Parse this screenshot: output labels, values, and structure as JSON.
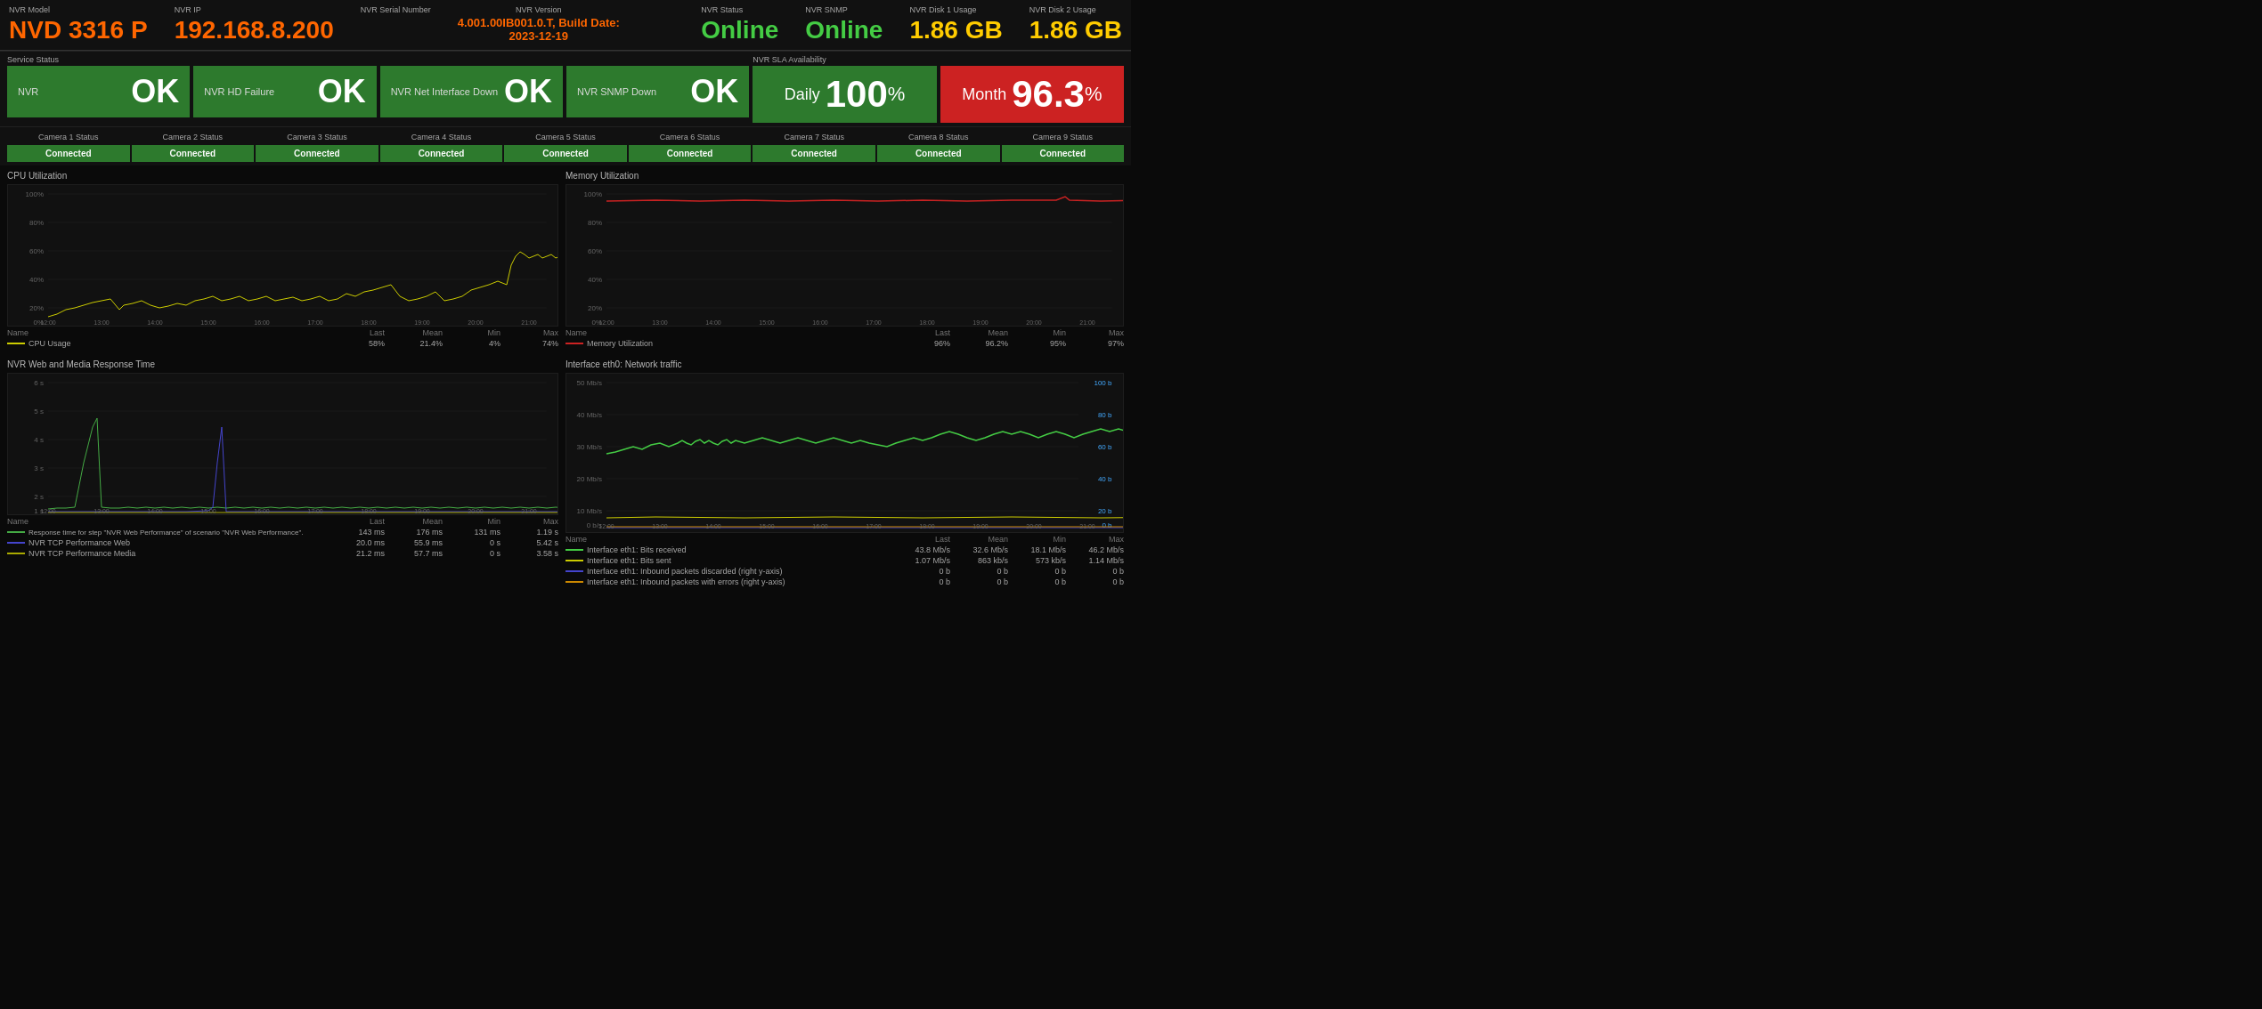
{
  "header": {
    "nvr_model_label": "NVR Model",
    "nvr_model_value": "NVD 3316 P",
    "nvr_ip_label": "NVR IP",
    "nvr_ip_value": "192.168.8.200",
    "nvr_serial_label": "NVR Serial Number",
    "nvr_serial_value": "",
    "nvr_version_label": "NVR Version",
    "nvr_version_value": "4.001.00IB001.0.T, Build Date:\n2023-12-19",
    "nvr_status_label": "NVR Status",
    "nvr_status_value": "Online",
    "nvr_snmp_label": "NVR SNMP",
    "nvr_snmp_value": "Online",
    "nvr_disk1_label": "NVR Disk 1 Usage",
    "nvr_disk1_value": "1.86 GB",
    "nvr_disk2_label": "NVR Disk 2 Usage",
    "nvr_disk2_value": "1.86 GB"
  },
  "service_status": {
    "section_label": "Service Status",
    "boxes": [
      {
        "label": "NVR",
        "value": "OK"
      },
      {
        "label": "NVR HD Failure",
        "value": "OK"
      },
      {
        "label": "NVR Net Interface Down",
        "value": "OK"
      },
      {
        "label": "NVR SNMP Down",
        "value": "OK"
      }
    ]
  },
  "sla": {
    "section_label": "NVR SLA Availability",
    "daily_label": "Daily",
    "daily_value": "100",
    "daily_unit": "%",
    "month_label": "Month",
    "month_value": "96.3",
    "month_unit": "%"
  },
  "cameras": {
    "labels": [
      "Camera 1 Status",
      "Camera 2 Status",
      "Camera 3 Status",
      "Camera 4 Status",
      "Camera 5 Status",
      "Camera 6 Status",
      "Camera 7 Status",
      "Camera 8 Status",
      "Camera 9 Status"
    ],
    "statuses": [
      "Connected",
      "Connected",
      "Connected",
      "Connected",
      "Connected",
      "Connected",
      "Connected",
      "Connected",
      "Connected"
    ]
  },
  "cpu_chart": {
    "title": "CPU Utilization",
    "legend_header": {
      "name": "Name",
      "last": "Last",
      "mean": "Mean",
      "min": "Min",
      "max": "Max"
    },
    "legend": [
      {
        "name": "CPU Usage",
        "color": "#cccc00",
        "last": "58%",
        "mean": "21.4%",
        "min": "4%",
        "max": "74%"
      }
    ]
  },
  "memory_chart": {
    "title": "Memory Utilization",
    "legend_header": {
      "name": "Name",
      "last": "Last",
      "mean": "Mean",
      "min": "Min",
      "max": "Max"
    },
    "legend": [
      {
        "name": "Memory Utilization",
        "color": "#cc2222",
        "last": "96%",
        "mean": "96.2%",
        "min": "95%",
        "max": "97%"
      }
    ]
  },
  "response_chart": {
    "title": "NVR Web and Media Response Time",
    "legend_header": {
      "name": "Name",
      "last": "Last",
      "mean": "Mean",
      "min": "Min",
      "max": "Max"
    },
    "legend": [
      {
        "name": "Response time for step \"NVR Web Performance\" of scenario \"NVR Web Performance\".",
        "color": "#44aa44",
        "last": "143 ms",
        "mean": "176 ms",
        "min": "131 ms",
        "max": "1.19 s"
      },
      {
        "name": "NVR TCP Performance Web",
        "color": "#4444cc",
        "last": "20.0 ms",
        "mean": "55.9 ms",
        "min": "0 s",
        "max": "5.42 s"
      },
      {
        "name": "NVR TCP Performance Media",
        "color": "#aaaa00",
        "last": "21.2 ms",
        "mean": "57.7 ms",
        "min": "0 s",
        "max": "3.58 s"
      }
    ]
  },
  "network_chart": {
    "title": "Interface eth0: Network traffic",
    "legend_header": {
      "name": "Name",
      "last": "Last",
      "mean": "Mean",
      "min": "Min",
      "max": "Max"
    },
    "legend": [
      {
        "name": "Interface eth1: Bits received",
        "color": "#44cc44",
        "last": "43.8 Mb/s",
        "mean": "32.6 Mb/s",
        "min": "18.1 Mb/s",
        "max": "46.2 Mb/s"
      },
      {
        "name": "Interface eth1: Bits sent",
        "color": "#cccc00",
        "last": "1.07 Mb/s",
        "mean": "863 kb/s",
        "min": "573 kb/s",
        "max": "1.14 Mb/s"
      },
      {
        "name": "Interface eth1: Inbound packets discarded (right y-axis)",
        "color": "#4444cc",
        "last": "0 b",
        "mean": "0 b",
        "min": "0 b",
        "max": "0 b"
      },
      {
        "name": "Interface eth1: Inbound packets with errors (right y-axis)",
        "color": "#cc8800",
        "last": "0 b",
        "mean": "0 b",
        "min": "0 b",
        "max": "0 b"
      }
    ]
  }
}
